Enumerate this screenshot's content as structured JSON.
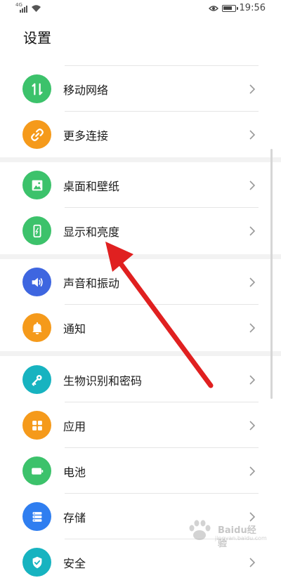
{
  "status_bar": {
    "network_label": "4G",
    "time": "19:56"
  },
  "page": {
    "title": "设置"
  },
  "items": [
    {
      "label": "移动网络",
      "icon": "swap-vertical-icon",
      "color": "#3cc26b"
    },
    {
      "label": "更多连接",
      "icon": "link-icon",
      "color": "#f59a1b"
    },
    {
      "label": "桌面和壁纸",
      "icon": "image-icon",
      "color": "#3cc26b"
    },
    {
      "label": "显示和亮度",
      "icon": "phone-brightness-icon",
      "color": "#3cc26b"
    },
    {
      "label": "声音和振动",
      "icon": "speaker-icon",
      "color": "#3e66e0"
    },
    {
      "label": "通知",
      "icon": "bell-icon",
      "color": "#f59a1b"
    },
    {
      "label": "生物识别和密码",
      "icon": "key-icon",
      "color": "#17b3c0"
    },
    {
      "label": "应用",
      "icon": "apps-grid-icon",
      "color": "#f59a1b"
    },
    {
      "label": "电池",
      "icon": "battery-icon",
      "color": "#3cc26b"
    },
    {
      "label": "存储",
      "icon": "storage-icon",
      "color": "#2f7ef0"
    },
    {
      "label": "安全",
      "icon": "shield-check-icon",
      "color": "#17b3c0"
    }
  ],
  "annotation": {
    "arrow_color": "#e02020"
  },
  "watermark": {
    "text": "Baidu经验",
    "sub": "jingyan.baidu.com"
  }
}
